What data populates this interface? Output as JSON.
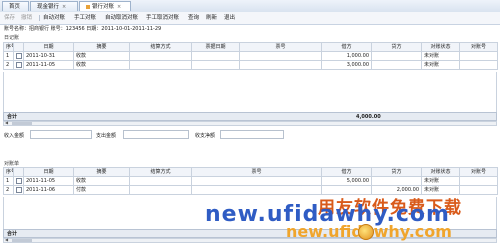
{
  "tabs": [
    {
      "label": "首页",
      "active": false
    },
    {
      "label": "现金银行",
      "active": false
    },
    {
      "label": "银行对账",
      "active": true
    }
  ],
  "toolbar": [
    {
      "label": "保存",
      "enabled": false
    },
    {
      "label": "撤销",
      "enabled": false
    },
    {
      "label": "自动对账",
      "enabled": true
    },
    {
      "label": "手工对账",
      "enabled": true
    },
    {
      "label": "自动取消对账",
      "enabled": true
    },
    {
      "label": "手工取消对账",
      "enabled": true
    },
    {
      "label": "查询",
      "enabled": true
    },
    {
      "label": "刷新",
      "enabled": true
    },
    {
      "label": "退出",
      "enabled": true
    }
  ],
  "info_line": "账号名称：招商银行 账号：123456 日期：2011-10-01-2011-11-29",
  "journal": {
    "title": "日记账",
    "columns": [
      "序号",
      "",
      "日期",
      "摘要",
      "结算方式",
      "票据日期",
      "票号",
      "借方",
      "贷方",
      "对账状态",
      "对账号"
    ],
    "rows": [
      {
        "no": "1",
        "date": "2011-10-31",
        "summary": "收款",
        "method": "",
        "bill_date": "",
        "bill_no": "",
        "debit": "1,000.00",
        "credit": "",
        "status": "未对账",
        "match": ""
      },
      {
        "no": "2",
        "date": "2011-11-05",
        "summary": "收款",
        "method": "",
        "bill_date": "",
        "bill_no": "",
        "debit": "3,000.00",
        "credit": "",
        "status": "未对账",
        "match": ""
      }
    ],
    "total_label": "合计",
    "total_debit": "4,000.00"
  },
  "filters": {
    "income_label": "收入金额",
    "expense_label": "支出金额",
    "net_label": "收支净额"
  },
  "statement": {
    "title": "对账单",
    "columns": [
      "序号",
      "",
      "日期",
      "摘要",
      "结算方式",
      "票号",
      "借方",
      "贷方",
      "对账状态",
      "对账号"
    ],
    "rows": [
      {
        "no": "1",
        "date": "2011-11-05",
        "summary": "收款",
        "method": "",
        "bill_no": "",
        "debit": "5,000.00",
        "credit": "",
        "status": "未对账",
        "match": ""
      },
      {
        "no": "2",
        "date": "2011-11-06",
        "summary": "付款",
        "method": "",
        "bill_no": "",
        "debit": "",
        "credit": "2,000.00",
        "status": "未对账",
        "match": ""
      }
    ],
    "total_label": "合计"
  },
  "watermark": {
    "brand": "用友软件免费下载",
    "url_blue": "new.ufidawhy.com",
    "url_orange": "new.ufidawhy.com"
  },
  "colors": {
    "watermark_orange": "#d95a1a",
    "watermark_blue": "#2f5cc4",
    "header_bg": "#f1f4f9"
  }
}
